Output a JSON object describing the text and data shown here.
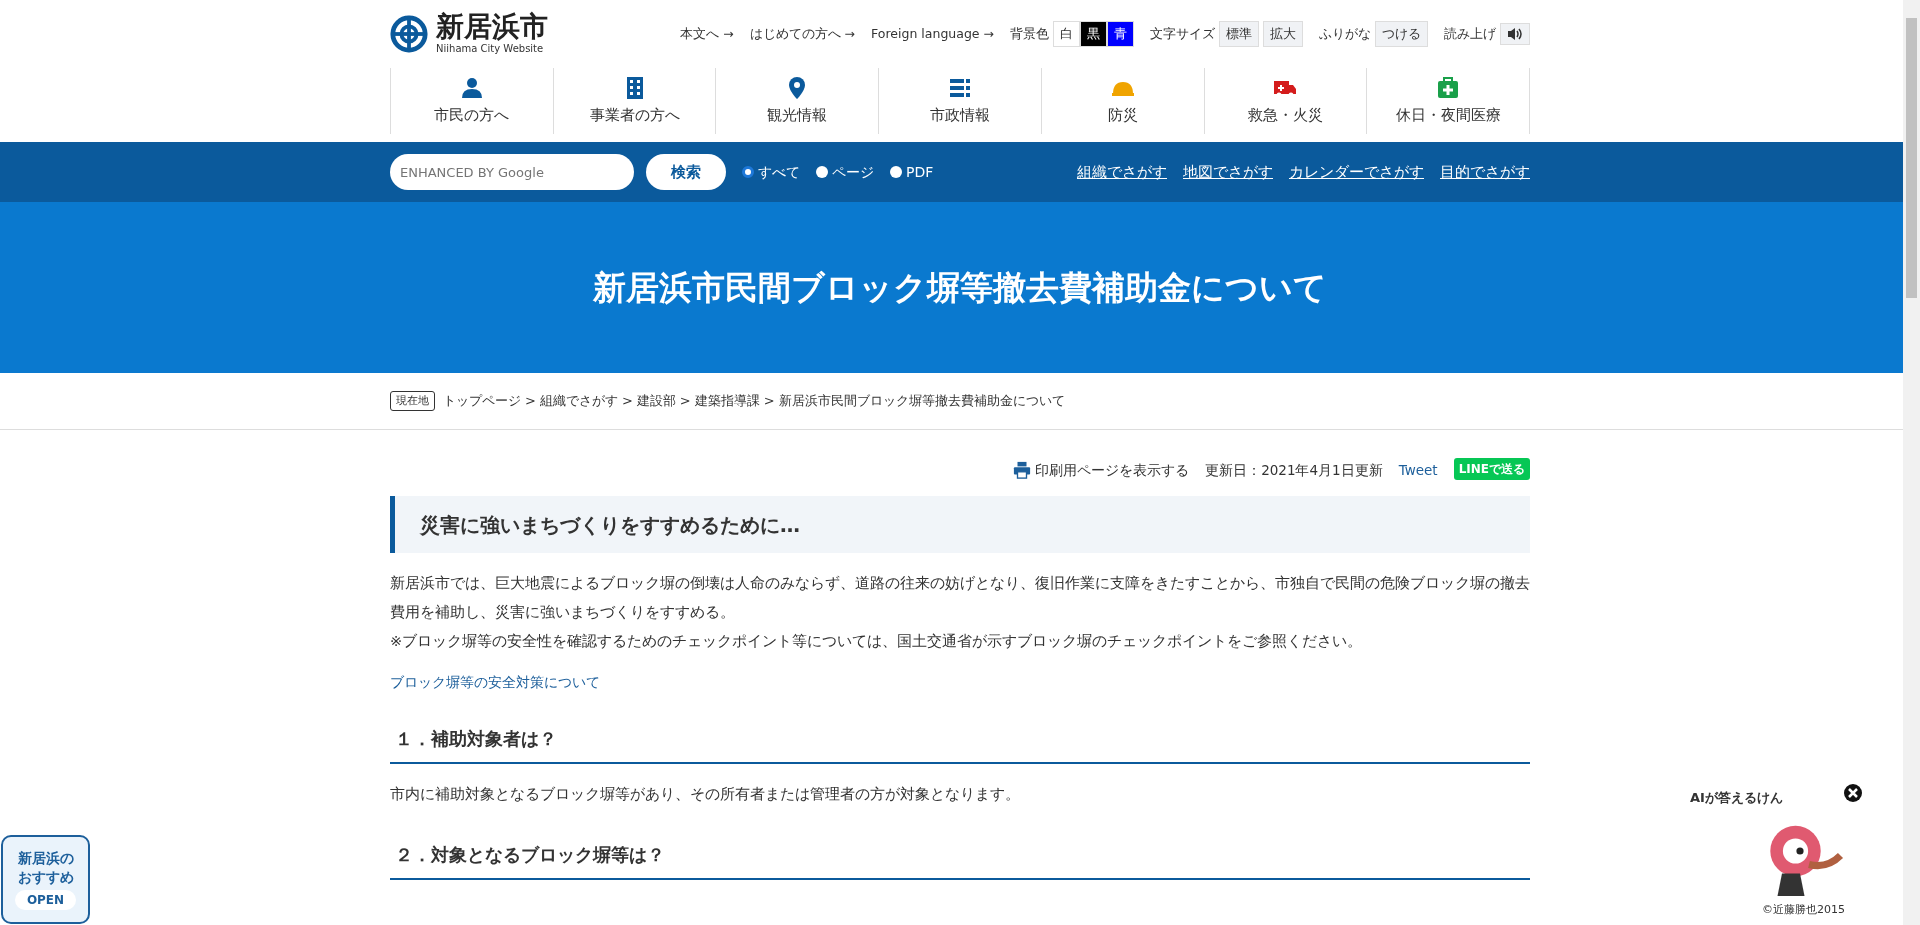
{
  "header": {
    "logo": {
      "name": "新居浜市",
      "subtitle": "Niihama City Website"
    },
    "utility_links": [
      "本文へ →",
      "はじめての方へ →",
      "Foreign language →"
    ],
    "bg_color": {
      "label": "背景色",
      "options": [
        "白",
        "黒",
        "青"
      ]
    },
    "font_size": {
      "label": "文字サイズ",
      "options": [
        "標準",
        "拡大"
      ]
    },
    "furigana": {
      "label": "ふりがな",
      "button": "つける"
    },
    "read_aloud": {
      "label": "読み上げ"
    }
  },
  "nav": [
    {
      "label": "市民の方へ"
    },
    {
      "label": "事業者の方へ"
    },
    {
      "label": "観光情報"
    },
    {
      "label": "市政情報"
    },
    {
      "label": "防災"
    },
    {
      "label": "救急・火災"
    },
    {
      "label": "休日・夜間医療"
    }
  ],
  "search": {
    "placeholder": "ENHANCED BY Google",
    "button": "検索",
    "scopes": [
      {
        "label": "すべて",
        "selected": true
      },
      {
        "label": "ページ",
        "selected": false
      },
      {
        "label": "PDF",
        "selected": false
      }
    ],
    "links": [
      "組織でさがす",
      "地図でさがす",
      "カレンダーでさがす",
      "目的でさがす"
    ]
  },
  "page_title": "新居浜市民間ブロック塀等撤去費補助金について",
  "breadcrumb": {
    "label": "現在地",
    "items": [
      "トップページ",
      "組織でさがす",
      "建設部",
      "建築指導課"
    ],
    "separator": ">",
    "current": "新居浜市民間ブロック塀等撤去費補助金について"
  },
  "meta": {
    "print": "印刷用ページを表示する",
    "updated": "更新日：2021年4月1日更新",
    "tweet": "Tweet",
    "line": "LINEで送る"
  },
  "section_heading": "災害に強いまちづくりをすすめるために…",
  "paragraphs": [
    "新居浜市では、巨大地震によるブロック塀の倒壊は人命のみならず、道路の往来の妨げとなり、復旧作業に支障をきたすことから、市独自で民間の危険ブロック塀の撤去費用を補助し、災害に強いまちづくりをすすめる。",
    "※ブロック塀等の安全性を確認するためのチェックポイント等については、国土交通省が示すブロック塀のチェックポイントをご参照ください。"
  ],
  "link": "ブロック塀等の安全対策について",
  "subsections": [
    {
      "heading": "１．補助対象者は？",
      "text": "市内に補助対象となるブロック塀等があり、その所有者または管理者の方が対象となります。"
    },
    {
      "heading": "２．対象となるブロック塀等は？"
    }
  ],
  "recommend": {
    "title": "新居浜のおすすめ",
    "button": "OPEN"
  },
  "chatbot": {
    "caption": "AIが答えるけん",
    "credit": "©近藤勝也2015"
  }
}
